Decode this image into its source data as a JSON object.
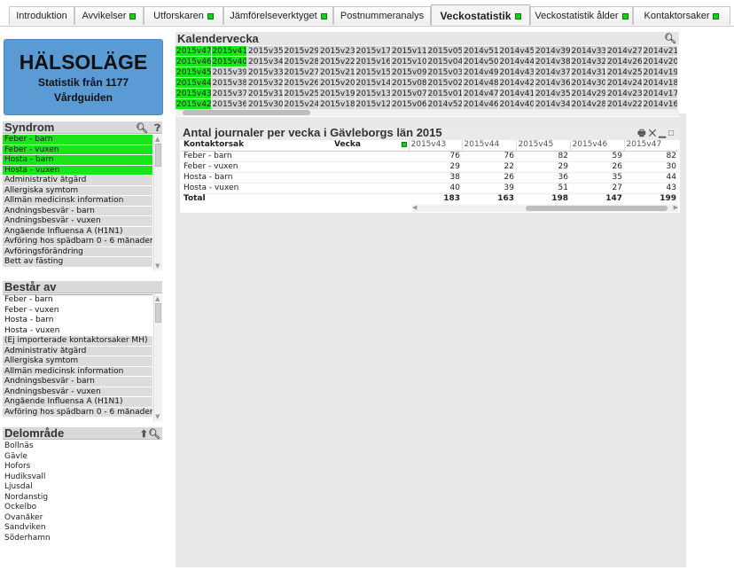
{
  "tabs": [
    {
      "label": "Introduktion",
      "dot": false,
      "active": false
    },
    {
      "label": "Avvikelser",
      "dot": true,
      "active": false
    },
    {
      "label": "Utforskaren",
      "dot": true,
      "active": false
    },
    {
      "label": "Jämförelseverktyget",
      "dot": true,
      "active": false
    },
    {
      "label": "Postnummeranalys",
      "dot": false,
      "active": false
    },
    {
      "label": "Veckostatistik",
      "dot": true,
      "active": true
    },
    {
      "label": "Veckostatistik ålder",
      "dot": true,
      "active": false
    },
    {
      "label": "Kontaktorsaker",
      "dot": true,
      "active": false
    }
  ],
  "logo": {
    "line1": "HÄLSOLÄGE",
    "line2": "Statistik från 1177",
    "line3": "Vårdguiden",
    "color": "#5b9bd5"
  },
  "kalender": {
    "title": "Kalendervecka",
    "rows": [
      [
        "2015v47",
        "2015v41",
        "2015v35",
        "2015v29",
        "2015v23",
        "2015v17",
        "2015v11",
        "2015v05",
        "2014v51",
        "2014v45",
        "2014v39",
        "2014v33",
        "2014v27",
        "2014v21"
      ],
      [
        "2015v46",
        "2015v40",
        "2015v34",
        "2015v28",
        "2015v22",
        "2015v16",
        "2015v10",
        "2015v04",
        "2014v50",
        "2014v44",
        "2014v38",
        "2014v32",
        "2014v26",
        "2014v20"
      ],
      [
        "2015v45",
        "2015v39",
        "2015v33",
        "2015v27",
        "2015v21",
        "2015v15",
        "2015v09",
        "2015v03",
        "2014v49",
        "2014v43",
        "2014v37",
        "2014v31",
        "2014v25",
        "2014v19"
      ],
      [
        "2015v44",
        "2015v38",
        "2015v32",
        "2015v26",
        "2015v20",
        "2015v14",
        "2015v08",
        "2015v02",
        "2014v48",
        "2014v42",
        "2014v36",
        "2014v30",
        "2014v24",
        "2014v18"
      ],
      [
        "2015v43",
        "2015v37",
        "2015v31",
        "2015v25",
        "2015v19",
        "2015v13",
        "2015v07",
        "2015v01",
        "2014v47",
        "2014v41",
        "2014v35",
        "2014v29",
        "2014v23",
        "2014v17"
      ],
      [
        "2015v42",
        "2015v36",
        "2015v30",
        "2015v24",
        "2015v18",
        "2015v12",
        "2015v06",
        "2014v52",
        "2014v46",
        "2014v40",
        "2014v34",
        "2014v28",
        "2014v22",
        "2014v16"
      ]
    ],
    "selected": [
      "2015v47",
      "2015v46",
      "2015v45",
      "2015v44",
      "2015v43",
      "2015v42",
      "2015v41",
      "2015v40"
    ]
  },
  "syndrom": {
    "title": "Syndrom",
    "items": [
      {
        "label": "Feber - barn",
        "state": "sel"
      },
      {
        "label": "Feber - vuxen",
        "state": "sel"
      },
      {
        "label": "Hosta - barn",
        "state": "sel"
      },
      {
        "label": "Hosta - vuxen",
        "state": "sel"
      },
      {
        "label": "Administrativ åtgärd",
        "state": "alt"
      },
      {
        "label": "Allergiska symtom",
        "state": "alt"
      },
      {
        "label": "Allmän medicinsk information",
        "state": "alt"
      },
      {
        "label": "Andningsbesvär - barn",
        "state": "alt"
      },
      {
        "label": "Andningsbesvär - vuxen",
        "state": "alt"
      },
      {
        "label": "Angående Influensa A (H1N1)",
        "state": "alt"
      },
      {
        "label": "Avföring hos spädbarn 0 - 6 månader",
        "state": "alt"
      },
      {
        "label": "Avföringsförändring",
        "state": "alt"
      },
      {
        "label": "Bett av fästing",
        "state": "alt"
      }
    ]
  },
  "bestar": {
    "title": "Består av",
    "items": [
      {
        "label": "Feber - barn",
        "state": "pos"
      },
      {
        "label": "Feber - vuxen",
        "state": "pos"
      },
      {
        "label": "Hosta - barn",
        "state": "pos"
      },
      {
        "label": "Hosta - vuxen",
        "state": "pos"
      },
      {
        "label": "(Ej importerade kontaktorsaker MH)",
        "state": "alt"
      },
      {
        "label": "Administrativ åtgärd",
        "state": "alt"
      },
      {
        "label": "Allergiska symtom",
        "state": "alt"
      },
      {
        "label": "Allmän medicinsk information",
        "state": "alt"
      },
      {
        "label": "Andningsbesvär - barn",
        "state": "alt"
      },
      {
        "label": "Andningsbesvär - vuxen",
        "state": "alt"
      },
      {
        "label": "Angående Influensa A (H1N1)",
        "state": "alt"
      },
      {
        "label": "Avföring hos spädbarn 0 - 6 månader",
        "state": "alt"
      }
    ]
  },
  "delomrade": {
    "title": "Delområde",
    "items": [
      "Bollnäs",
      "Gävle",
      "Hofors",
      "Hudiksvall",
      "Ljusdal",
      "Nordanstig",
      "Ockelbo",
      "Ovanåker",
      "Sandviken",
      "Söderhamn"
    ]
  },
  "table": {
    "title": "Antal journaler per vecka i Gävleborgs län 2015",
    "col1": "Kontaktorsak",
    "col2": "Vecka",
    "weeks": [
      "2015v43",
      "2015v44",
      "2015v45",
      "2015v46",
      "2015v47"
    ],
    "rows": [
      {
        "label": "Feber - barn",
        "values": [
          76,
          76,
          82,
          59,
          82
        ]
      },
      {
        "label": "Feber - vuxen",
        "values": [
          29,
          22,
          29,
          26,
          30
        ]
      },
      {
        "label": "Hosta - barn",
        "values": [
          38,
          26,
          36,
          35,
          44
        ]
      },
      {
        "label": "Hosta - vuxen",
        "values": [
          40,
          39,
          51,
          27,
          43
        ]
      }
    ],
    "total": {
      "label": "Total",
      "values": [
        183,
        163,
        198,
        147,
        199
      ]
    }
  }
}
